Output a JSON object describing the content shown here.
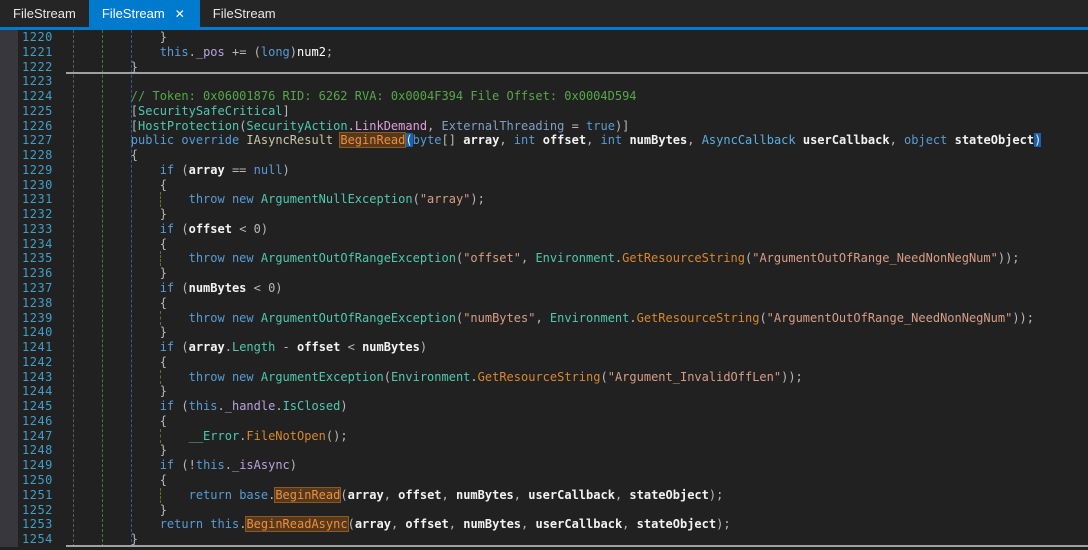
{
  "window_title": "FileStream decompiled source view",
  "tabs": [
    {
      "label": "FileStream",
      "active": false
    },
    {
      "label": "FileStream",
      "active": true,
      "close_glyph": "✕"
    },
    {
      "label": "FileStream",
      "active": false
    }
  ],
  "palette": {
    "accent": "#007ACC",
    "tabbar-bg": "#252526",
    "tab-fg": "#E8E8E8",
    "bg": "#212121",
    "glyph-bg": "#37373D",
    "ln": "#3F9FC9",
    "divider": "#A0A0A0",
    "guide-gray": "#5A5A5A",
    "guide-green": "#3C7B46",
    "guide-blue": "#2D5D9E",
    "guide-olive": "#6B6B2E",
    "pn": "#B8B8B8",
    "kw": "#569CD6",
    "cm": "#57A64A",
    "ty": "#4EC9B0",
    "intf": "#C8C8A8",
    "dg": "#5AAFE0",
    "st": "#D69D85",
    "ef": "#DD9FDF",
    "np": "#7E9FC7",
    "fi": "#B9A3DC",
    "pr": "#4EC9B0",
    "sm": "#D7882D",
    "loc": "#FFFFFF",
    "pm": "#F2F2F2",
    "hlref-fg": "#E89041",
    "hlref-bg": "#58381A",
    "hlref-border": "#8A5A22",
    "hlbrace-bg": "#1662B0"
  },
  "editor": {
    "first_line": 1220,
    "last_line": 1254,
    "lines": [
      {
        "n": 1220,
        "t": [
          [
            "pn",
            "            }"
          ]
        ]
      },
      {
        "n": 1221,
        "t": [
          [
            "pn",
            "            "
          ],
          [
            "kw",
            "this"
          ],
          [
            "pn",
            "."
          ],
          [
            "fi",
            "_pos"
          ],
          [
            "pn",
            " += ("
          ],
          [
            "kw",
            "long"
          ],
          [
            "pn",
            ")"
          ],
          [
            "loc",
            "num2"
          ],
          [
            "pn",
            ";"
          ]
        ]
      },
      {
        "n": 1222,
        "d": true,
        "t": [
          [
            "pn",
            "        }"
          ]
        ]
      },
      {
        "n": 1223,
        "t": []
      },
      {
        "n": 1224,
        "t": [
          [
            "cm",
            "        // Token: 0x06001876 RID: 6262 RVA: 0x0004F394 File Offset: 0x0004D594"
          ]
        ]
      },
      {
        "n": 1225,
        "t": [
          [
            "pn",
            "        ["
          ],
          [
            "ty",
            "SecuritySafeCritical"
          ],
          [
            "pn",
            "]"
          ]
        ]
      },
      {
        "n": 1226,
        "t": [
          [
            "pn",
            "        ["
          ],
          [
            "ty",
            "HostProtection"
          ],
          [
            "pn",
            "("
          ],
          [
            "ty",
            "SecurityAction"
          ],
          [
            "pn",
            "."
          ],
          [
            "ef",
            "LinkDemand"
          ],
          [
            "pn",
            ", "
          ],
          [
            "np",
            "ExternalThreading"
          ],
          [
            "pn",
            " = "
          ],
          [
            "kw",
            "true"
          ],
          [
            "pn",
            ")]"
          ]
        ]
      },
      {
        "n": 1227,
        "t": [
          [
            "pn",
            "        "
          ],
          [
            "kw",
            "public"
          ],
          [
            "pn",
            " "
          ],
          [
            "kw",
            "override"
          ],
          [
            "pn",
            " "
          ],
          [
            "if",
            "IAsyncResult"
          ],
          [
            "pn",
            " "
          ],
          [
            "hlref",
            "BeginRead"
          ],
          [
            "hlbrace",
            "("
          ],
          [
            "kw",
            "byte"
          ],
          [
            "pn",
            "[] "
          ],
          [
            "pm",
            "array"
          ],
          [
            "pn",
            ", "
          ],
          [
            "kw",
            "int"
          ],
          [
            "pn",
            " "
          ],
          [
            "pm",
            "offset"
          ],
          [
            "pn",
            ", "
          ],
          [
            "kw",
            "int"
          ],
          [
            "pn",
            " "
          ],
          [
            "pm",
            "numBytes"
          ],
          [
            "pn",
            ", "
          ],
          [
            "dg",
            "AsyncCallback"
          ],
          [
            "pn",
            " "
          ],
          [
            "pm",
            "userCallback"
          ],
          [
            "pn",
            ", "
          ],
          [
            "kw",
            "object"
          ],
          [
            "pn",
            " "
          ],
          [
            "pm",
            "stateObject"
          ],
          [
            "hlbrace",
            ")"
          ]
        ]
      },
      {
        "n": 1228,
        "t": [
          [
            "pn",
            "        {"
          ]
        ]
      },
      {
        "n": 1229,
        "t": [
          [
            "pn",
            "            "
          ],
          [
            "kw",
            "if"
          ],
          [
            "pn",
            " ("
          ],
          [
            "pm",
            "array"
          ],
          [
            "pn",
            " == "
          ],
          [
            "kw",
            "null"
          ],
          [
            "pn",
            ")"
          ]
        ]
      },
      {
        "n": 1230,
        "t": [
          [
            "pn",
            "            {"
          ]
        ]
      },
      {
        "n": 1231,
        "g": true,
        "t": [
          [
            "pn",
            "                "
          ],
          [
            "kw",
            "throw"
          ],
          [
            "pn",
            " "
          ],
          [
            "kw",
            "new"
          ],
          [
            "pn",
            " "
          ],
          [
            "ty",
            "ArgumentNullException"
          ],
          [
            "pn",
            "("
          ],
          [
            "st",
            "\"array\""
          ],
          [
            "pn",
            ");"
          ]
        ]
      },
      {
        "n": 1232,
        "t": [
          [
            "pn",
            "            }"
          ]
        ]
      },
      {
        "n": 1233,
        "t": [
          [
            "pn",
            "            "
          ],
          [
            "kw",
            "if"
          ],
          [
            "pn",
            " ("
          ],
          [
            "pm",
            "offset"
          ],
          [
            "pn",
            " < 0)"
          ]
        ]
      },
      {
        "n": 1234,
        "t": [
          [
            "pn",
            "            {"
          ]
        ]
      },
      {
        "n": 1235,
        "g": true,
        "t": [
          [
            "pn",
            "                "
          ],
          [
            "kw",
            "throw"
          ],
          [
            "pn",
            " "
          ],
          [
            "kw",
            "new"
          ],
          [
            "pn",
            " "
          ],
          [
            "ty",
            "ArgumentOutOfRangeException"
          ],
          [
            "pn",
            "("
          ],
          [
            "st",
            "\"offset\""
          ],
          [
            "pn",
            ", "
          ],
          [
            "ty",
            "Environment"
          ],
          [
            "pn",
            "."
          ],
          [
            "sm",
            "GetResourceString"
          ],
          [
            "pn",
            "("
          ],
          [
            "st",
            "\"ArgumentOutOfRange_NeedNonNegNum\""
          ],
          [
            "pn",
            "));"
          ]
        ]
      },
      {
        "n": 1236,
        "t": [
          [
            "pn",
            "            }"
          ]
        ]
      },
      {
        "n": 1237,
        "t": [
          [
            "pn",
            "            "
          ],
          [
            "kw",
            "if"
          ],
          [
            "pn",
            " ("
          ],
          [
            "pm",
            "numBytes"
          ],
          [
            "pn",
            " < 0)"
          ]
        ]
      },
      {
        "n": 1238,
        "t": [
          [
            "pn",
            "            {"
          ]
        ]
      },
      {
        "n": 1239,
        "g": true,
        "t": [
          [
            "pn",
            "                "
          ],
          [
            "kw",
            "throw"
          ],
          [
            "pn",
            " "
          ],
          [
            "kw",
            "new"
          ],
          [
            "pn",
            " "
          ],
          [
            "ty",
            "ArgumentOutOfRangeException"
          ],
          [
            "pn",
            "("
          ],
          [
            "st",
            "\"numBytes\""
          ],
          [
            "pn",
            ", "
          ],
          [
            "ty",
            "Environment"
          ],
          [
            "pn",
            "."
          ],
          [
            "sm",
            "GetResourceString"
          ],
          [
            "pn",
            "("
          ],
          [
            "st",
            "\"ArgumentOutOfRange_NeedNonNegNum\""
          ],
          [
            "pn",
            "));"
          ]
        ]
      },
      {
        "n": 1240,
        "t": [
          [
            "pn",
            "            }"
          ]
        ]
      },
      {
        "n": 1241,
        "t": [
          [
            "pn",
            "            "
          ],
          [
            "kw",
            "if"
          ],
          [
            "pn",
            " ("
          ],
          [
            "pm",
            "array"
          ],
          [
            "pn",
            "."
          ],
          [
            "pr",
            "Length"
          ],
          [
            "pn",
            " - "
          ],
          [
            "pm",
            "offset"
          ],
          [
            "pn",
            " < "
          ],
          [
            "pm",
            "numBytes"
          ],
          [
            "pn",
            ")"
          ]
        ]
      },
      {
        "n": 1242,
        "t": [
          [
            "pn",
            "            {"
          ]
        ]
      },
      {
        "n": 1243,
        "g": true,
        "t": [
          [
            "pn",
            "                "
          ],
          [
            "kw",
            "throw"
          ],
          [
            "pn",
            " "
          ],
          [
            "kw",
            "new"
          ],
          [
            "pn",
            " "
          ],
          [
            "ty",
            "ArgumentException"
          ],
          [
            "pn",
            "("
          ],
          [
            "ty",
            "Environment"
          ],
          [
            "pn",
            "."
          ],
          [
            "sm",
            "GetResourceString"
          ],
          [
            "pn",
            "("
          ],
          [
            "st",
            "\"Argument_InvalidOffLen\""
          ],
          [
            "pn",
            "));"
          ]
        ]
      },
      {
        "n": 1244,
        "t": [
          [
            "pn",
            "            }"
          ]
        ]
      },
      {
        "n": 1245,
        "t": [
          [
            "pn",
            "            "
          ],
          [
            "kw",
            "if"
          ],
          [
            "pn",
            " ("
          ],
          [
            "kw",
            "this"
          ],
          [
            "pn",
            "."
          ],
          [
            "fi",
            "_handle"
          ],
          [
            "pn",
            "."
          ],
          [
            "pr",
            "IsClosed"
          ],
          [
            "pn",
            ")"
          ]
        ]
      },
      {
        "n": 1246,
        "t": [
          [
            "pn",
            "            {"
          ]
        ]
      },
      {
        "n": 1247,
        "g": true,
        "t": [
          [
            "pn",
            "                "
          ],
          [
            "ty",
            "__Error"
          ],
          [
            "pn",
            "."
          ],
          [
            "sm",
            "FileNotOpen"
          ],
          [
            "pn",
            "();"
          ]
        ]
      },
      {
        "n": 1248,
        "t": [
          [
            "pn",
            "            }"
          ]
        ]
      },
      {
        "n": 1249,
        "t": [
          [
            "pn",
            "            "
          ],
          [
            "kw",
            "if"
          ],
          [
            "pn",
            " (!"
          ],
          [
            "kw",
            "this"
          ],
          [
            "pn",
            "."
          ],
          [
            "fi",
            "_isAsync"
          ],
          [
            "pn",
            ")"
          ]
        ]
      },
      {
        "n": 1250,
        "t": [
          [
            "pn",
            "            {"
          ]
        ]
      },
      {
        "n": 1251,
        "g": true,
        "t": [
          [
            "pn",
            "                "
          ],
          [
            "kw",
            "return"
          ],
          [
            "pn",
            " "
          ],
          [
            "kw",
            "base"
          ],
          [
            "pn",
            "."
          ],
          [
            "hlref",
            "BeginRead"
          ],
          [
            "pn",
            "("
          ],
          [
            "pm",
            "array"
          ],
          [
            "pn",
            ", "
          ],
          [
            "pm",
            "offset"
          ],
          [
            "pn",
            ", "
          ],
          [
            "pm",
            "numBytes"
          ],
          [
            "pn",
            ", "
          ],
          [
            "pm",
            "userCallback"
          ],
          [
            "pn",
            ", "
          ],
          [
            "pm",
            "stateObject"
          ],
          [
            "pn",
            ");"
          ]
        ]
      },
      {
        "n": 1252,
        "t": [
          [
            "pn",
            "            }"
          ]
        ]
      },
      {
        "n": 1253,
        "t": [
          [
            "pn",
            "            "
          ],
          [
            "kw",
            "return"
          ],
          [
            "pn",
            " "
          ],
          [
            "kw",
            "this"
          ],
          [
            "pn",
            "."
          ],
          [
            "hlref",
            "BeginReadAsync"
          ],
          [
            "pn",
            "("
          ],
          [
            "pm",
            "array"
          ],
          [
            "pn",
            ", "
          ],
          [
            "pm",
            "offset"
          ],
          [
            "pn",
            ", "
          ],
          [
            "pm",
            "numBytes"
          ],
          [
            "pn",
            ", "
          ],
          [
            "pm",
            "userCallback"
          ],
          [
            "pn",
            ", "
          ],
          [
            "pm",
            "stateObject"
          ],
          [
            "pn",
            ");"
          ]
        ]
      },
      {
        "n": 1254,
        "d": true,
        "t": [
          [
            "pn",
            "        }"
          ]
        ]
      }
    ]
  }
}
